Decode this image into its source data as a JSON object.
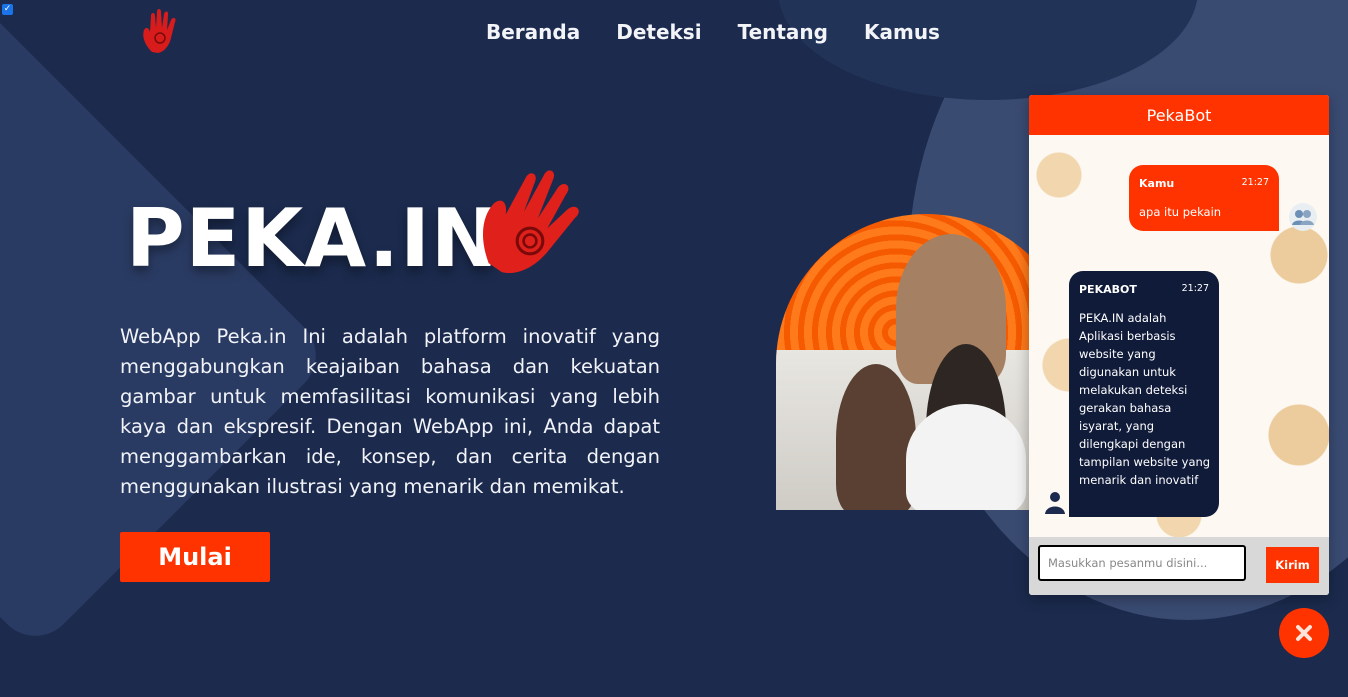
{
  "colors": {
    "accent": "#ff3300",
    "background": "#1b2a4d",
    "bot_bubble": "#101b3a"
  },
  "nav": {
    "items": [
      "Beranda",
      "Deteksi",
      "Tentang",
      "Kamus"
    ]
  },
  "hero": {
    "title": "PEKA.IN",
    "description": "WebApp Peka.in Ini adalah platform inovatif yang menggabungkan keajaiban bahasa dan kekuatan gambar untuk memfasilitasi komunikasi yang lebih kaya dan ekspresif. Dengan WebApp ini, Anda dapat menggambarkan ide, konsep, dan cerita dengan menggunakan ilustrasi yang menarik dan memikat.",
    "button_label": "Mulai"
  },
  "chat": {
    "header": "PekaBot",
    "messages": [
      {
        "sender": "Kamu",
        "time": "21:27",
        "text": "apa itu pekain"
      },
      {
        "sender": "PEKABOT",
        "time": "21:27",
        "text": "PEKA.IN adalah Aplikasi berbasis website yang digunakan untuk melakukan deteksi gerakan bahasa isyarat, yang dilengkapi dengan tampilan website yang menarik dan inovatif"
      }
    ],
    "input_placeholder": "Masukkan pesanmu disini...",
    "send_label": "Kirim"
  },
  "icons": {
    "logo": "red-hand-icon",
    "close": "close-icon",
    "user_avatar": "users-icon",
    "bot_avatar": "bot-avatar-icon"
  }
}
